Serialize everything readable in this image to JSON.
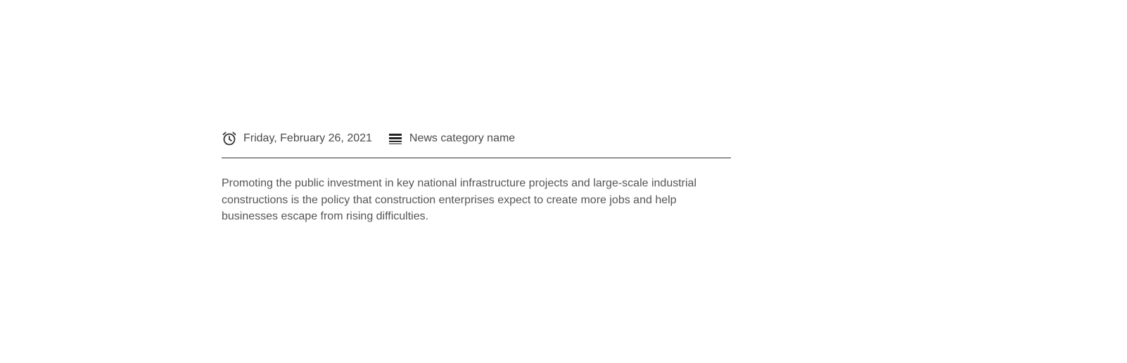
{
  "article": {
    "date": {
      "icon": "alarm-clock-icon",
      "text": "Friday, February 26, 2021"
    },
    "category": {
      "icon": "list-lines-icon",
      "text": "News category name"
    },
    "summary": "Promoting the public investment in key national infrastructure projects and large-scale industrial constructions is the policy that construction enterprises expect to create more jobs and help businesses escape from rising difficulties."
  },
  "colors": {
    "text": "#4a4a4a",
    "divider": "#333333",
    "background": "#ffffff"
  }
}
